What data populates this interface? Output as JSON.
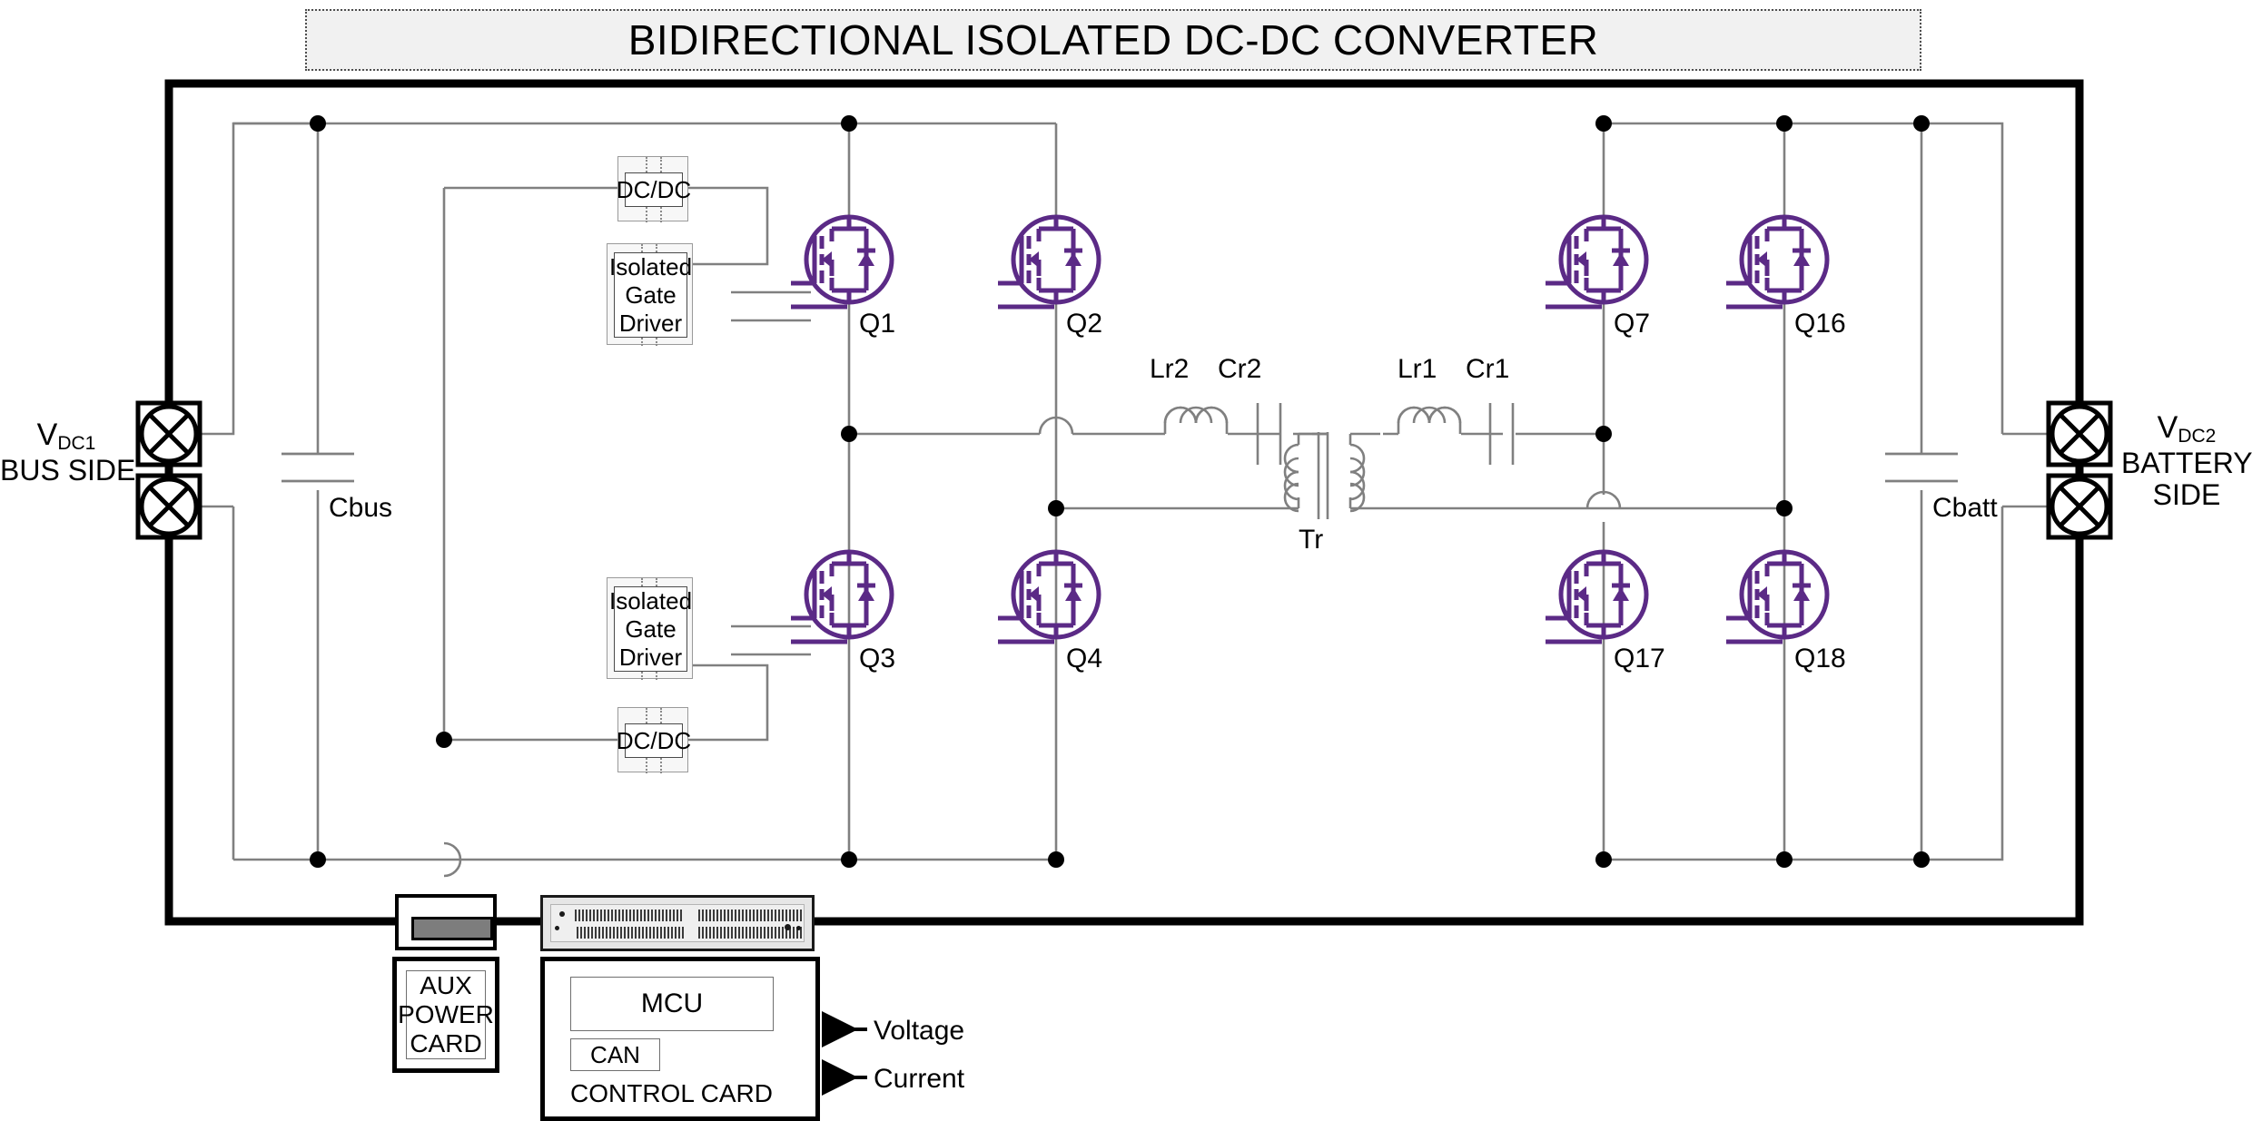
{
  "title": "BIDIRECTIONAL ISOLATED DC-DC CONVERTER",
  "terminals": {
    "left": {
      "v": "V",
      "sub": "DC1",
      "line2": "BUS SIDE",
      "icon": "terminal-cross-icon"
    },
    "right": {
      "v": "V",
      "sub": "DC2",
      "line2": "BATTERY",
      "line3": "SIDE",
      "icon": "terminal-cross-icon"
    }
  },
  "capacitors": [
    {
      "name": "Cbus"
    },
    {
      "name": "Cbatt"
    }
  ],
  "mosfets": [
    {
      "id": "Q1"
    },
    {
      "id": "Q2"
    },
    {
      "id": "Q7"
    },
    {
      "id": "Q16"
    },
    {
      "id": "Q3"
    },
    {
      "id": "Q4"
    },
    {
      "id": "Q17"
    },
    {
      "id": "Q18"
    }
  ],
  "gate_drivers": [
    {
      "label_line1": "Isolated",
      "label_line2": "Gate",
      "label_line3": "Driver"
    },
    {
      "label_line1": "Isolated",
      "label_line2": "Gate",
      "label_line3": "Driver"
    }
  ],
  "dcdc_blocks": [
    {
      "label": "DC/DC"
    },
    {
      "label": "DC/DC"
    }
  ],
  "resonant_tank": {
    "left": {
      "inductor": "Lr2",
      "capacitor": "Cr2"
    },
    "right": {
      "inductor": "Lr1",
      "capacitor": "Cr1"
    },
    "transformer": "Tr"
  },
  "aux_power_card": {
    "line1": "AUX",
    "line2": "POWER",
    "line3": "CARD"
  },
  "control_card": {
    "mcu": "MCU",
    "can": "CAN",
    "caption": "CONTROL CARD",
    "signals": [
      {
        "label": "Voltage"
      },
      {
        "label": "Current"
      }
    ]
  },
  "colors": {
    "mosfet_purple": "#5b2a86",
    "wire_gray": "#808080",
    "frame_black": "#000000",
    "block_fill": "#f7f7f7",
    "title_fill": "#f1f1f1"
  }
}
